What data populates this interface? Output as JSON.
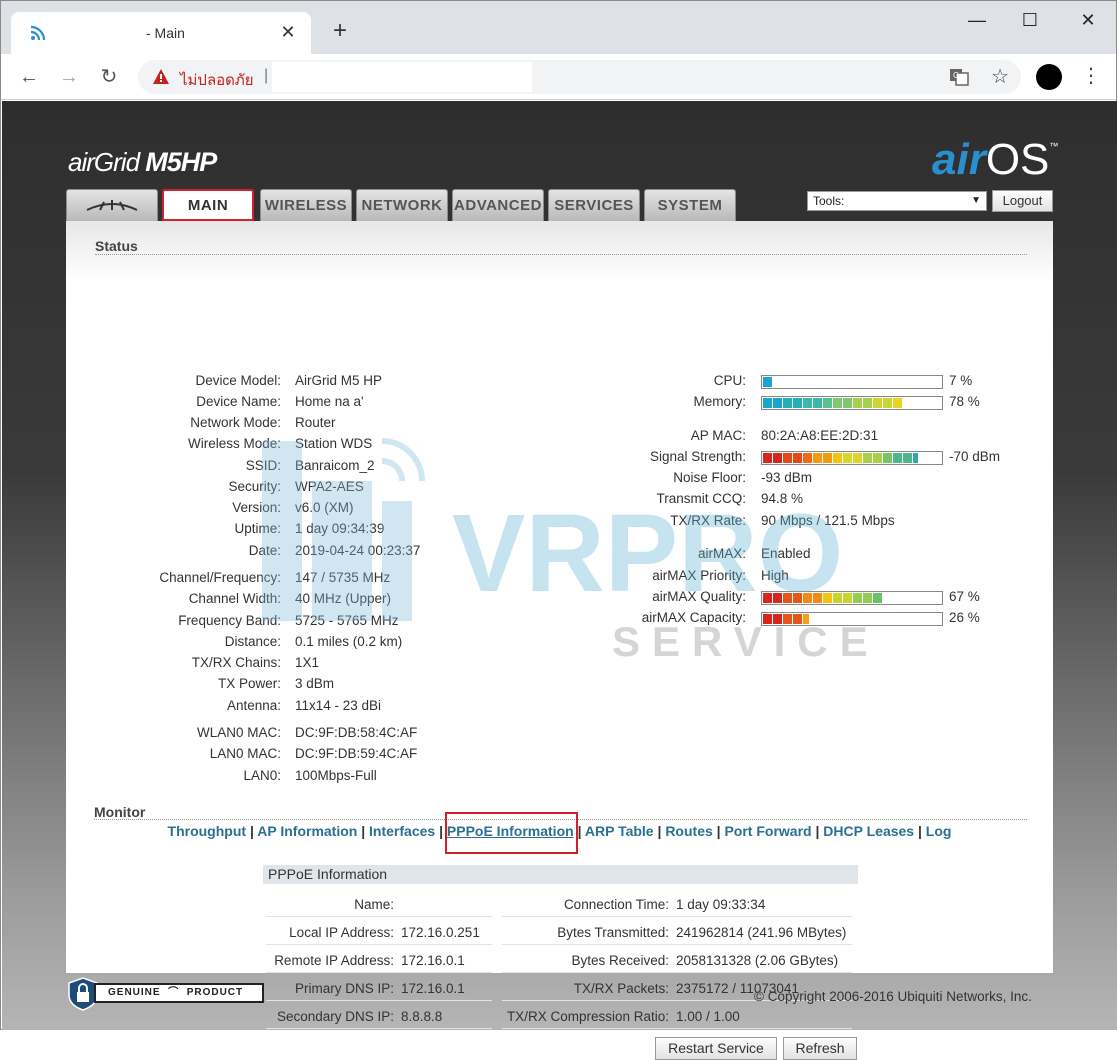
{
  "browser": {
    "tab_title": "- Main",
    "insecure_label": "ไม่ปลอดภัย",
    "new_tab": "+",
    "tab_close": "✕",
    "minimize": "—",
    "maximize": "☐",
    "close": "✕"
  },
  "brand": {
    "device_air": "air",
    "device_grid": "Grid",
    "device_model": "M5HP",
    "os_air": "air",
    "os_name": "OS",
    "os_tm": "™"
  },
  "nav": {
    "tabs": [
      "MAIN",
      "WIRELESS",
      "NETWORK",
      "ADVANCED",
      "SERVICES",
      "SYSTEM"
    ],
    "tools_label": "Tools:",
    "logout": "Logout"
  },
  "status": {
    "title": "Status",
    "left": [
      {
        "label": "Device Model:",
        "value": "AirGrid M5 HP"
      },
      {
        "label": "Device Name:",
        "value": "Home na a'"
      },
      {
        "label": "Network Mode:",
        "value": "Router"
      },
      {
        "label": "Wireless Mode:",
        "value": "Station WDS"
      },
      {
        "label": "SSID:",
        "value": "Banraicom_2"
      },
      {
        "label": "Security:",
        "value": "WPA2-AES"
      },
      {
        "label": "Version:",
        "value": "v6.0 (XM)"
      },
      {
        "label": "Uptime:",
        "value": "1 day 09:34:39"
      },
      {
        "label": "Date:",
        "value": "2019-04-24 00:23:37"
      },
      {
        "label": "Channel/Frequency:",
        "value": "147 / 5735 MHz"
      },
      {
        "label": "Channel Width:",
        "value": "40 MHz (Upper)"
      },
      {
        "label": "Frequency Band:",
        "value": "5725 - 5765 MHz"
      },
      {
        "label": "Distance:",
        "value": "0.1 miles (0.2 km)"
      },
      {
        "label": "TX/RX Chains:",
        "value": "1X1"
      },
      {
        "label": "TX Power:",
        "value": "3 dBm"
      },
      {
        "label": "Antenna:",
        "value": "11x14 - 23 dBi"
      },
      {
        "label": "WLAN0 MAC:",
        "value": "DC:9F:DB:58:4C:AF"
      },
      {
        "label": "LAN0 MAC:",
        "value": "DC:9F:DB:59:4C:AF"
      },
      {
        "label": "LAN0:",
        "value": "100Mbps-Full"
      }
    ],
    "right": [
      {
        "label": "CPU:",
        "value": "7 %",
        "level": 0.07
      },
      {
        "label": "Memory:",
        "value": "78 %",
        "level": 0.78
      },
      {
        "label": "AP MAC:",
        "value": "80:2A:A8:EE:2D:31"
      },
      {
        "label": "Signal Strength:",
        "value": "-70 dBm",
        "level": 0.87
      },
      {
        "label": "Noise Floor:",
        "value": "-93 dBm"
      },
      {
        "label": "Transmit CCQ:",
        "value": "94.8 %"
      },
      {
        "label": "TX/RX Rate:",
        "value": "90 Mbps / 121.5 Mbps"
      },
      {
        "label": "airMAX:",
        "value": "Enabled"
      },
      {
        "label": "airMAX Priority:",
        "value": "High"
      },
      {
        "label": "airMAX Quality:",
        "value": "67 %",
        "level": 0.67
      },
      {
        "label": "airMAX Capacity:",
        "value": "26 %",
        "level": 0.26
      }
    ]
  },
  "monitor": {
    "title": "Monitor",
    "links": [
      "Throughput",
      "AP Information",
      "Interfaces",
      "PPPoE Information",
      "ARP Table",
      "Routes",
      "Port Forward",
      "DHCP Leases",
      "Log"
    ],
    "separator": " | "
  },
  "pppoe": {
    "header": "PPPoE Information",
    "left": [
      {
        "label": "Name:",
        "value": ""
      },
      {
        "label": "Local IP Address:",
        "value": "172.16.0.251"
      },
      {
        "label": "Remote IP Address:",
        "value": "172.16.0.1"
      },
      {
        "label": "Primary DNS IP:",
        "value": "172.16.0.1"
      },
      {
        "label": "Secondary DNS IP:",
        "value": "8.8.8.8"
      }
    ],
    "right": [
      {
        "label": "Connection Time:",
        "value": "1 day 09:33:34"
      },
      {
        "label": "Bytes Transmitted:",
        "value": "241962814 (241.96 MBytes)"
      },
      {
        "label": "Bytes Received:",
        "value": "2058131328 (2.06 GBytes)"
      },
      {
        "label": "TX/RX Packets:",
        "value": "2375172 / 11073041"
      },
      {
        "label": "TX/RX Compression Ratio:",
        "value": "1.00 / 1.00"
      }
    ],
    "restart_button": "Restart Service",
    "refresh_button": "Refresh"
  },
  "footer": {
    "genuine": "GENUINE",
    "product": "PRODUCT",
    "copyright": "© Copyright 2006-2016 Ubiquiti Networks, Inc."
  },
  "watermark": {
    "line1": "VRPRO",
    "line2": "SERVICE"
  },
  "colors": {
    "accent_red": "#d0212b",
    "link_blue": "#2b6f93",
    "cpu_bar": "#1aa3d9"
  }
}
